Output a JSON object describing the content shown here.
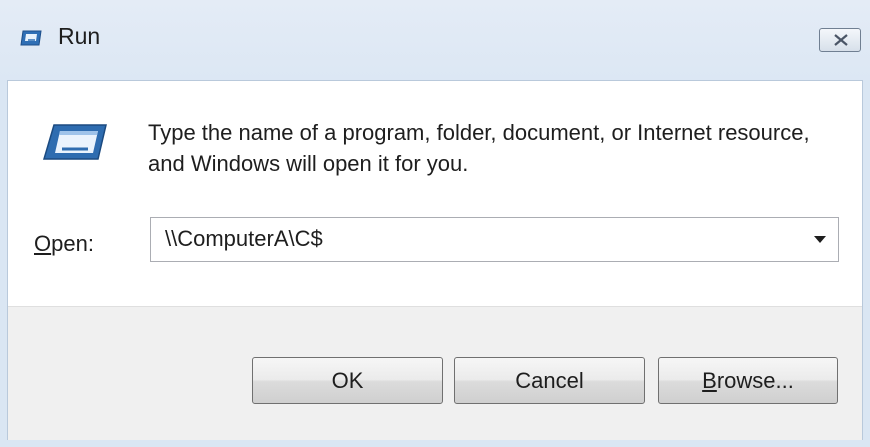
{
  "window": {
    "title": "Run",
    "title_icon": "run-icon",
    "close_icon": "close-icon"
  },
  "dialog": {
    "description": "Type the name of a program, folder, document, or Internet resource, and Windows will open it for you.",
    "big_icon": "run-icon",
    "open_label_mnemonic": "O",
    "open_label_rest": "pen:",
    "open_value": "\\\\ComputerA\\C$",
    "dropdown_icon": "chevron-down-icon"
  },
  "buttons": {
    "ok": "OK",
    "cancel": "Cancel",
    "browse_mnemonic": "B",
    "browse_rest": "rowse..."
  },
  "colors": {
    "title_bar": "#dce7f4",
    "client_bg": "#ffffff",
    "footer_bg": "#f0f0f0"
  }
}
